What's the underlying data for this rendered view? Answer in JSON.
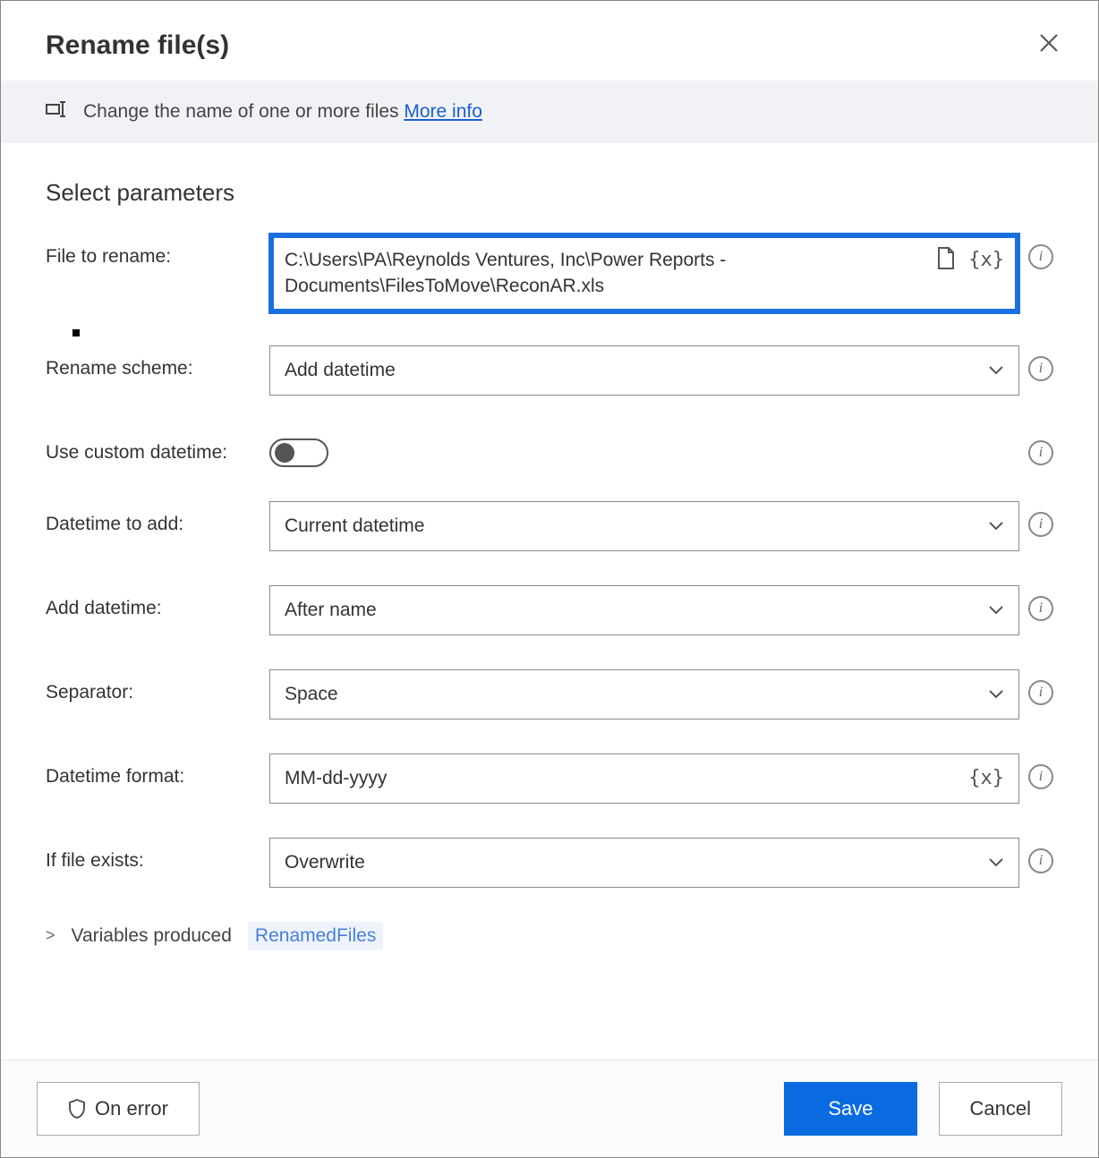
{
  "header": {
    "title": "Rename file(s)"
  },
  "banner": {
    "text": "Change the name of one or more files ",
    "link": "More info"
  },
  "section_title": "Select parameters",
  "fields": {
    "file_to_rename": {
      "label": "File to rename:",
      "value": "C:\\Users\\PA\\Reynolds Ventures, Inc\\Power Reports - Documents\\FilesToMove\\ReconAR.xls"
    },
    "rename_scheme": {
      "label": "Rename scheme:",
      "value": "Add datetime"
    },
    "use_custom_datetime": {
      "label": "Use custom datetime:",
      "value": false
    },
    "datetime_to_add": {
      "label": "Datetime to add:",
      "value": "Current datetime"
    },
    "add_datetime": {
      "label": "Add datetime:",
      "value": "After name"
    },
    "separator": {
      "label": "Separator:",
      "value": "Space"
    },
    "datetime_format": {
      "label": "Datetime format:",
      "value": "MM-dd-yyyy"
    },
    "if_file_exists": {
      "label": "If file exists:",
      "value": "Overwrite"
    }
  },
  "variables": {
    "caret": ">",
    "label": "Variables produced",
    "chip": "RenamedFiles"
  },
  "footer": {
    "on_error": "On error",
    "save": "Save",
    "cancel": "Cancel"
  },
  "glyphs": {
    "varx": "{x}"
  }
}
